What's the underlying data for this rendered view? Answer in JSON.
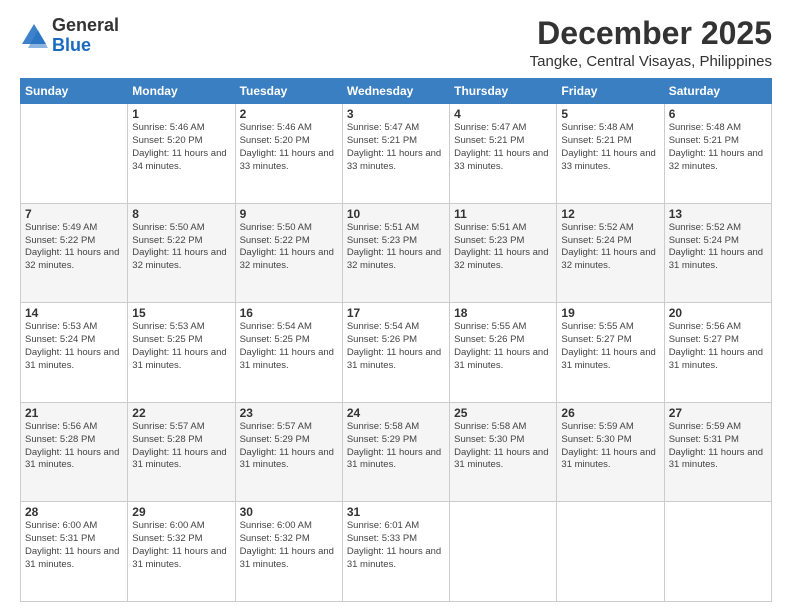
{
  "header": {
    "logo_general": "General",
    "logo_blue": "Blue",
    "title": "December 2025",
    "subtitle": "Tangke, Central Visayas, Philippines"
  },
  "days_of_week": [
    "Sunday",
    "Monday",
    "Tuesday",
    "Wednesday",
    "Thursday",
    "Friday",
    "Saturday"
  ],
  "weeks": [
    [
      {
        "day": "",
        "sunrise": "",
        "sunset": "",
        "daylight": ""
      },
      {
        "day": "1",
        "sunrise": "Sunrise: 5:46 AM",
        "sunset": "Sunset: 5:20 PM",
        "daylight": "Daylight: 11 hours and 34 minutes."
      },
      {
        "day": "2",
        "sunrise": "Sunrise: 5:46 AM",
        "sunset": "Sunset: 5:20 PM",
        "daylight": "Daylight: 11 hours and 33 minutes."
      },
      {
        "day": "3",
        "sunrise": "Sunrise: 5:47 AM",
        "sunset": "Sunset: 5:21 PM",
        "daylight": "Daylight: 11 hours and 33 minutes."
      },
      {
        "day": "4",
        "sunrise": "Sunrise: 5:47 AM",
        "sunset": "Sunset: 5:21 PM",
        "daylight": "Daylight: 11 hours and 33 minutes."
      },
      {
        "day": "5",
        "sunrise": "Sunrise: 5:48 AM",
        "sunset": "Sunset: 5:21 PM",
        "daylight": "Daylight: 11 hours and 33 minutes."
      },
      {
        "day": "6",
        "sunrise": "Sunrise: 5:48 AM",
        "sunset": "Sunset: 5:21 PM",
        "daylight": "Daylight: 11 hours and 32 minutes."
      }
    ],
    [
      {
        "day": "7",
        "sunrise": "Sunrise: 5:49 AM",
        "sunset": "Sunset: 5:22 PM",
        "daylight": "Daylight: 11 hours and 32 minutes."
      },
      {
        "day": "8",
        "sunrise": "Sunrise: 5:50 AM",
        "sunset": "Sunset: 5:22 PM",
        "daylight": "Daylight: 11 hours and 32 minutes."
      },
      {
        "day": "9",
        "sunrise": "Sunrise: 5:50 AM",
        "sunset": "Sunset: 5:22 PM",
        "daylight": "Daylight: 11 hours and 32 minutes."
      },
      {
        "day": "10",
        "sunrise": "Sunrise: 5:51 AM",
        "sunset": "Sunset: 5:23 PM",
        "daylight": "Daylight: 11 hours and 32 minutes."
      },
      {
        "day": "11",
        "sunrise": "Sunrise: 5:51 AM",
        "sunset": "Sunset: 5:23 PM",
        "daylight": "Daylight: 11 hours and 32 minutes."
      },
      {
        "day": "12",
        "sunrise": "Sunrise: 5:52 AM",
        "sunset": "Sunset: 5:24 PM",
        "daylight": "Daylight: 11 hours and 32 minutes."
      },
      {
        "day": "13",
        "sunrise": "Sunrise: 5:52 AM",
        "sunset": "Sunset: 5:24 PM",
        "daylight": "Daylight: 11 hours and 31 minutes."
      }
    ],
    [
      {
        "day": "14",
        "sunrise": "Sunrise: 5:53 AM",
        "sunset": "Sunset: 5:24 PM",
        "daylight": "Daylight: 11 hours and 31 minutes."
      },
      {
        "day": "15",
        "sunrise": "Sunrise: 5:53 AM",
        "sunset": "Sunset: 5:25 PM",
        "daylight": "Daylight: 11 hours and 31 minutes."
      },
      {
        "day": "16",
        "sunrise": "Sunrise: 5:54 AM",
        "sunset": "Sunset: 5:25 PM",
        "daylight": "Daylight: 11 hours and 31 minutes."
      },
      {
        "day": "17",
        "sunrise": "Sunrise: 5:54 AM",
        "sunset": "Sunset: 5:26 PM",
        "daylight": "Daylight: 11 hours and 31 minutes."
      },
      {
        "day": "18",
        "sunrise": "Sunrise: 5:55 AM",
        "sunset": "Sunset: 5:26 PM",
        "daylight": "Daylight: 11 hours and 31 minutes."
      },
      {
        "day": "19",
        "sunrise": "Sunrise: 5:55 AM",
        "sunset": "Sunset: 5:27 PM",
        "daylight": "Daylight: 11 hours and 31 minutes."
      },
      {
        "day": "20",
        "sunrise": "Sunrise: 5:56 AM",
        "sunset": "Sunset: 5:27 PM",
        "daylight": "Daylight: 11 hours and 31 minutes."
      }
    ],
    [
      {
        "day": "21",
        "sunrise": "Sunrise: 5:56 AM",
        "sunset": "Sunset: 5:28 PM",
        "daylight": "Daylight: 11 hours and 31 minutes."
      },
      {
        "day": "22",
        "sunrise": "Sunrise: 5:57 AM",
        "sunset": "Sunset: 5:28 PM",
        "daylight": "Daylight: 11 hours and 31 minutes."
      },
      {
        "day": "23",
        "sunrise": "Sunrise: 5:57 AM",
        "sunset": "Sunset: 5:29 PM",
        "daylight": "Daylight: 11 hours and 31 minutes."
      },
      {
        "day": "24",
        "sunrise": "Sunrise: 5:58 AM",
        "sunset": "Sunset: 5:29 PM",
        "daylight": "Daylight: 11 hours and 31 minutes."
      },
      {
        "day": "25",
        "sunrise": "Sunrise: 5:58 AM",
        "sunset": "Sunset: 5:30 PM",
        "daylight": "Daylight: 11 hours and 31 minutes."
      },
      {
        "day": "26",
        "sunrise": "Sunrise: 5:59 AM",
        "sunset": "Sunset: 5:30 PM",
        "daylight": "Daylight: 11 hours and 31 minutes."
      },
      {
        "day": "27",
        "sunrise": "Sunrise: 5:59 AM",
        "sunset": "Sunset: 5:31 PM",
        "daylight": "Daylight: 11 hours and 31 minutes."
      }
    ],
    [
      {
        "day": "28",
        "sunrise": "Sunrise: 6:00 AM",
        "sunset": "Sunset: 5:31 PM",
        "daylight": "Daylight: 11 hours and 31 minutes."
      },
      {
        "day": "29",
        "sunrise": "Sunrise: 6:00 AM",
        "sunset": "Sunset: 5:32 PM",
        "daylight": "Daylight: 11 hours and 31 minutes."
      },
      {
        "day": "30",
        "sunrise": "Sunrise: 6:00 AM",
        "sunset": "Sunset: 5:32 PM",
        "daylight": "Daylight: 11 hours and 31 minutes."
      },
      {
        "day": "31",
        "sunrise": "Sunrise: 6:01 AM",
        "sunset": "Sunset: 5:33 PM",
        "daylight": "Daylight: 11 hours and 31 minutes."
      },
      {
        "day": "",
        "sunrise": "",
        "sunset": "",
        "daylight": ""
      },
      {
        "day": "",
        "sunrise": "",
        "sunset": "",
        "daylight": ""
      },
      {
        "day": "",
        "sunrise": "",
        "sunset": "",
        "daylight": ""
      }
    ]
  ]
}
